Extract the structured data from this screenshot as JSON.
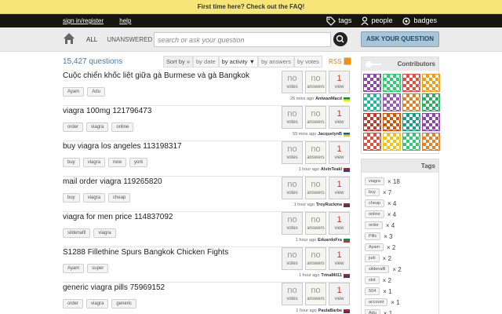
{
  "notify": {
    "text": "First time here? Check out the FAQ!"
  },
  "header": {
    "signin": "sign in/register",
    "help": "help",
    "nav": {
      "tags": "tags",
      "people": "people",
      "badges": "badges"
    }
  },
  "searchbar": {
    "tab_all": "ALL",
    "tab_unanswered": "UNANSWERED",
    "placeholder": "search or ask your question",
    "ask_button": "ASK YOUR QUESTION"
  },
  "main": {
    "count": "15,427 questions",
    "sort_label": "Sort by »",
    "sort_date": "by date",
    "sort_activity": "by activity ▼",
    "sort_answers": "by answers",
    "sort_votes": "by votes",
    "rss": "RSS"
  },
  "questions": [
    {
      "title": "Cuộc chiến khốc liệt giữa gà Burmese và gà Bangkok",
      "tags": [
        "Ayam",
        "Adu"
      ],
      "votes": "no",
      "answers": "no",
      "views": "1",
      "time": "26 mins ago",
      "user": "AntwanMacd"
    },
    {
      "title": "viagra 100mg 121796473",
      "tags": [
        "order",
        "viagra",
        "online"
      ],
      "votes": "no",
      "answers": "no",
      "views": "1",
      "time": "55 mins ago",
      "user": "JacquelynB"
    },
    {
      "title": "buy viagra los angeles 113198317",
      "tags": [
        "buy",
        "viagra",
        "new",
        "york"
      ],
      "votes": "no",
      "answers": "no",
      "views": "1",
      "time": "1 hour ago",
      "user": "AlvinTeakl"
    },
    {
      "title": "mail order viagra 119265820",
      "tags": [
        "buy",
        "viagra",
        "cheap"
      ],
      "votes": "no",
      "answers": "no",
      "views": "1",
      "time": "1 hour ago",
      "user": "TroyRuckma"
    },
    {
      "title": "viagra for men price 114837092",
      "tags": [
        "sildenafil",
        "viagra"
      ],
      "votes": "no",
      "answers": "no",
      "views": "1",
      "time": "1 hour ago",
      "user": "EduardoFra"
    },
    {
      "title": "S1288 Fillethine Spurs Bangkok Chicken Fights",
      "tags": [
        "Ayam",
        "super"
      ],
      "votes": "no",
      "answers": "no",
      "views": "1",
      "time": "1 hour ago",
      "user": "TrinaMil11"
    },
    {
      "title": "generic viagra pills 75969152",
      "tags": [
        "order",
        "viagra",
        "generic"
      ],
      "votes": "no",
      "answers": "no",
      "views": "1",
      "time": "1 hour ago",
      "user": "PaulaBarbe"
    }
  ],
  "labels": {
    "votes": "votes",
    "answers": "answers",
    "view": "view"
  },
  "sidebar": {
    "contributors_title": "Contributors",
    "tags_title": "Tags",
    "tags": [
      {
        "name": "viagra",
        "count": "× 18"
      },
      {
        "name": "buy",
        "count": "× 7"
      },
      {
        "name": "cheap",
        "count": "× 4"
      },
      {
        "name": "online",
        "count": "× 4"
      },
      {
        "name": "order",
        "count": "× 4"
      },
      {
        "name": "Pills",
        "count": "× 3"
      },
      {
        "name": "Ayam",
        "count": "× 2"
      },
      {
        "name": "judi",
        "count": "× 2"
      },
      {
        "name": "sildenafil",
        "count": "× 2"
      },
      {
        "name": "slot",
        "count": "× 2"
      },
      {
        "name": "504",
        "count": "× 1"
      },
      {
        "name": "account",
        "count": "× 1"
      },
      {
        "name": "Adu",
        "count": "× 1"
      }
    ]
  },
  "colors": {
    "notify": "#f8e577",
    "header": "#16160e",
    "ask_button": "#a9c5d6",
    "view_count": "#c0392b"
  }
}
